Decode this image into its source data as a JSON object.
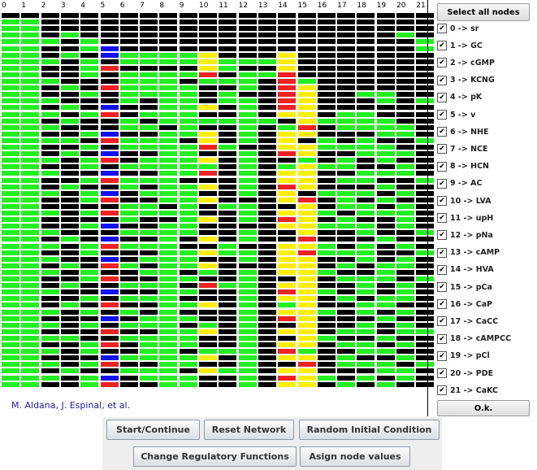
{
  "grid": {
    "column_labels": [
      "0",
      "1",
      "2",
      "3",
      "4",
      "5",
      "6",
      "7",
      "8",
      "9",
      "10",
      "11",
      "12",
      "13",
      "14",
      "15",
      "16",
      "17",
      "18",
      "19",
      "20",
      "21"
    ],
    "colors": {
      "G": "#22ee22",
      "K": "#000000",
      "R": "#ee2222",
      "Y": "#ffee00",
      "B": "#1010ee"
    },
    "rows": [
      "KKKKKKKKKKKKKKKKKKKKKK",
      "GGKKKKKKKKKKKKKKKKKKKK",
      "GGKKKKKKKKKKKKKKKKKKKK",
      "GGKGKKKKKKKKKKKKKKKKGK",
      "GGGKGKKKKKKKKKKKKKKKKG",
      "GGKKGBKKKKKKKKKKKKKKKG",
      "GGKGKBGGGGYKKKYKKKKKKK",
      "GGGKGKGGGGYGGGYKKKKKKK",
      "GGKKGRKKKKYGKKYKKKKKKK",
      "GGKKGKGGGGRKGGRKKKKKKK",
      "GGGKKKGGGKGGGKRGKKKKKK",
      "GGKGKRGGGGKKGKRYKKKKKK",
      "GGKKGKGGGGKGKKRYKKGGKK",
      "GGGKKKGKGGKGGKRYKKKGKG",
      "GGKGKBKKGGYKGKRYKKKKKK",
      "GGGKGRKGGGKKGKYYKGGKKK",
      "GGKGKKGKGGGGGGKYGGGGKK",
      "GGGKKKGGKGKKGKGRKGGGGK",
      "GGKKGBKKGGYKGKYYKKKGGK",
      "GGGGKRGGGKYKGKYKGKGKKG",
      "GGKKGKGGGGRGKKYYGGGGKK",
      "GGKGKBKKGGKKGKRYKKGGGK",
      "GGGKGRKGGGYKGKKGKGKGKK",
      "GGKKGKGGGGGKGKGYGGKKGK",
      "GGGKKBKKGGRKGKYYKKGGGK",
      "GGKKGRGGGKKKGKYYKGGKKG",
      "GGKGKKGKGGYKGKRYKKKGKK",
      "GGGKGBKGGGKKGKYKGGGKGK",
      "GGKKGRKKGGYKKKYRKGKGKK",
      "GGKKKKGGKGKGGKKYKGGKGK",
      "GGGKGRGGGGKKGKYYGKGGGK",
      "GGKKKKGKKGYKGKRYKGKKGK",
      "GGKKGBKKGGKKKKYYGGGKGK",
      "GGGKKKGGGGKKGKKYKKGKKG",
      "GGKGKBKKGKYKGKKRKKKGKK",
      "GGGKGRGGGKKGKKYYGKGKGK",
      "GGKKGKKKGGYGGKYRGGGKKG",
      "GGGKKBKGGGKKGKYYKKGKGK",
      "GGKGKRGKGGYKKKYYKGKGGK",
      "GGGKGKKGGKGKGKYYGKKGKK",
      "GGKKGRKKGGKKGKKYKGGGKG",
      "GGKGKKGGGKRGGKYYKKGKGK",
      "GGGKKBKKGGKKGKRYGKGKGK",
      "GGKKGKGGGKKKGKYYKGKGGK",
      "GGKGKRKKGGYKGKGYKKGGKK",
      "GGGKGKGKGKKKGKYYGKGKGK",
      "GGKKKBKGGGKKGKRYKKKGKK",
      "GGGKGKGGGKGKGKKYKKGKGK",
      "GGKKKRKKGGYKGKYYKGGKGG",
      "GGGGKKGGGGKKGKKYGKKGKK",
      "GGKKGRKGGGKKGKYYKGGKGK",
      "GGGKGKKGGKGGGKRGKKGGKK",
      "GGKKKBGGGGYKGKYYKGKKGK",
      "GGGKGRKKGGKKGKKRKGGGKG",
      "GGKGKKGGGKYGGKYYKKKGGK",
      "GGGKGBKGGGKKGKRYGKGKGK",
      "GGKKGRKKGGKKGKYYKGKGKK"
    ]
  },
  "credits": "M. Aldana, J. Espinal, et al.",
  "side_panel": {
    "select_all_label": "Select all nodes",
    "ok_label": "O.k.",
    "check_mark": "✔",
    "nodes": [
      {
        "label": "0 -> sr",
        "checked": true
      },
      {
        "label": "1 -> GC",
        "checked": true
      },
      {
        "label": "2 -> cGMP",
        "checked": true
      },
      {
        "label": "3 -> KCNG",
        "checked": true
      },
      {
        "label": "4 -> pK",
        "checked": true
      },
      {
        "label": "5 -> v",
        "checked": true
      },
      {
        "label": "6 -> NHE",
        "checked": true
      },
      {
        "label": "7 -> NCE",
        "checked": true
      },
      {
        "label": "8 -> HCN",
        "checked": true
      },
      {
        "label": "9 -> AC",
        "checked": true
      },
      {
        "label": "10 -> LVA",
        "checked": true
      },
      {
        "label": "11 -> upH",
        "checked": true
      },
      {
        "label": "12 -> pNa",
        "checked": true
      },
      {
        "label": "13 -> cAMP",
        "checked": true
      },
      {
        "label": "14 -> HVA",
        "checked": true
      },
      {
        "label": "15 -> pCa",
        "checked": true
      },
      {
        "label": "16 -> CaP",
        "checked": true
      },
      {
        "label": "17 -> CaCC",
        "checked": true
      },
      {
        "label": "18 -> cAMPCC",
        "checked": true
      },
      {
        "label": "19 -> pCl",
        "checked": true
      },
      {
        "label": "20 -> PDE",
        "checked": true
      },
      {
        "label": "21 -> CaKC",
        "checked": true
      }
    ]
  },
  "buttons": {
    "start": "Start/Continue",
    "reset": "Reset Network",
    "random": "Random Initial Condition",
    "change": "Change Regulatory Functions",
    "assign": "Asign node values"
  }
}
